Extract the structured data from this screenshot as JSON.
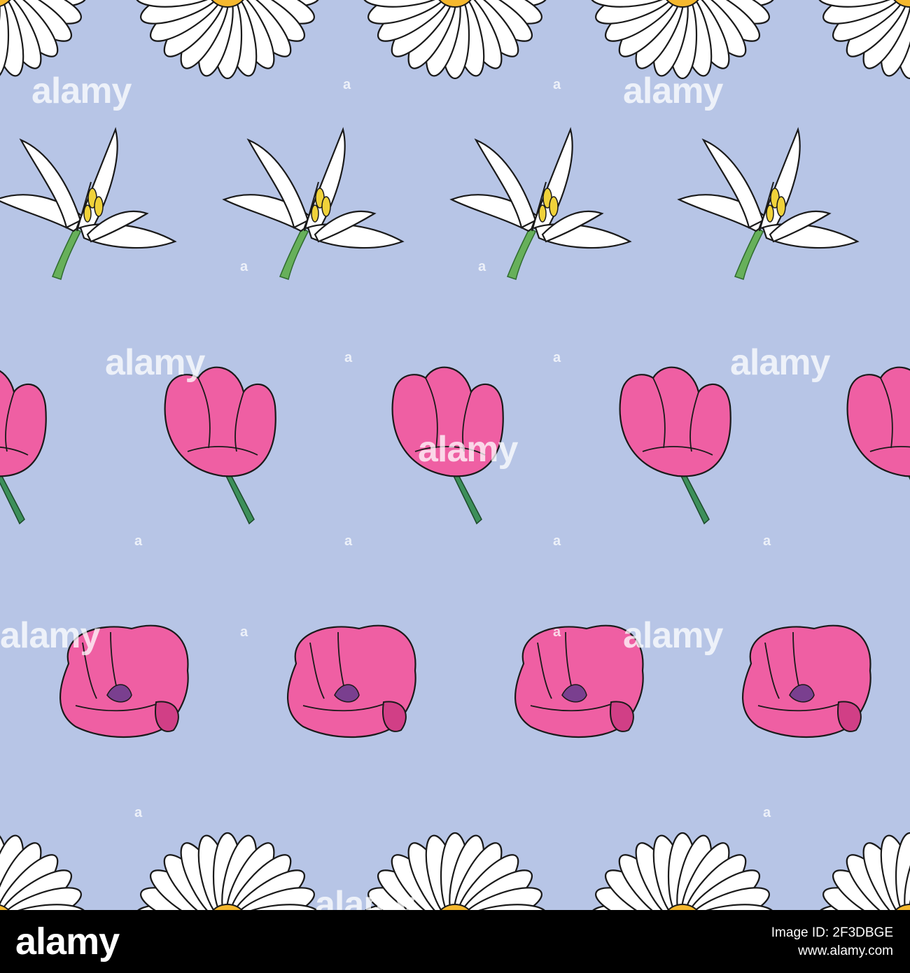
{
  "pattern": {
    "background_color": "#b7c5e6",
    "rows": [
      "daisy",
      "lily",
      "tulip",
      "open-tulip",
      "daisy"
    ],
    "colors": {
      "petal_white": "#ffffff",
      "outline": "#1a1a1a",
      "daisy_center": "#f5b82e",
      "lily_stamen": "#f0d23a",
      "stem_green": "#67b05a",
      "tulip_stem": "#3d8f5a",
      "tulip_pink": "#ef5fa3",
      "tulip_dark": "#d13f86",
      "pistil_purple": "#7a3f8f"
    }
  },
  "watermark": {
    "text": "alamy",
    "mark": "a"
  },
  "footer": {
    "logo": "alamy",
    "image_id_label": "Image ID: 2F3DBGE",
    "site": "www.alamy.com"
  }
}
